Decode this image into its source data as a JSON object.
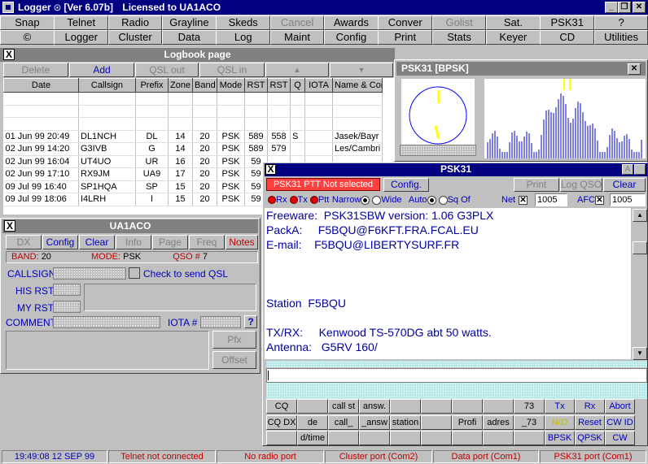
{
  "window": {
    "title": "Logger",
    "version": "[Ver 6.07b]",
    "license": "Licensed to UA1ACO",
    "min_symbol": "_",
    "restore_symbol": "❐",
    "close_symbol": "✕"
  },
  "menu_row1": [
    "Snap",
    "Telnet",
    "Radio",
    "Grayline",
    "Skeds",
    "Cancel",
    "Awards",
    "Conver",
    "Golist",
    "Sat.",
    "PSK31",
    "?"
  ],
  "menu_row2": [
    "©",
    "Logger",
    "Cluster",
    "Data",
    "Log",
    "Maint",
    "Config",
    "Print",
    "Stats",
    "Keyer",
    "CD",
    "Utilities"
  ],
  "logbook": {
    "title": "Logbook page",
    "close_label": "X",
    "toolbar": {
      "delete": "Delete",
      "add": "Add",
      "qsl_out": "QSL out",
      "qsl_in": "QSL in",
      "up": "▲",
      "down": "▼"
    },
    "columns": [
      "Date",
      "Callsign",
      "Prefix",
      "Zone",
      "Band",
      "Mode",
      "RST",
      "RST",
      "Q",
      "IOTA",
      "Name & Com"
    ],
    "rows": [
      [
        "01 Jun 99  20:49",
        "DL1NCH",
        "DL",
        "14",
        "20",
        "PSK",
        "589",
        "558",
        "S",
        "",
        "Jasek/Bayr"
      ],
      [
        "02 Jun 99  14:20",
        "G3IVB",
        "G",
        "14",
        "20",
        "PSK",
        "589",
        "579",
        "",
        "",
        "Les/Cambri"
      ],
      [
        "02 Jun 99  16:04",
        "UT4UO",
        "UR",
        "16",
        "20",
        "PSK",
        "59",
        "",
        "",
        "",
        ""
      ],
      [
        "02 Jun 99  17:10",
        "RX9JM",
        "UA9",
        "17",
        "20",
        "PSK",
        "59",
        "",
        "",
        "",
        ""
      ],
      [
        "09 Jul 99  16:40",
        "SP1HQA",
        "SP",
        "15",
        "20",
        "PSK",
        "59",
        "",
        "",
        "",
        ""
      ],
      [
        "09 Jul 99  18:06",
        "I4LRH",
        "I",
        "15",
        "20",
        "PSK",
        "59",
        "",
        "",
        "",
        ""
      ]
    ]
  },
  "qso_panel": {
    "title": "UA1ACO",
    "close_label": "X",
    "buttons": {
      "dx": "DX",
      "config": "Config",
      "clear": "Clear",
      "info": "Info",
      "page": "Page",
      "freq": "Freq",
      "notes": "Notes"
    },
    "band_label": "BAND:",
    "band_value": "20",
    "mode_label": "MODE:",
    "mode_value": "PSK",
    "qso_label": "QSO #",
    "qso_value": "7",
    "callsign_label": "CALLSIGN",
    "check_qsl_label": "Check to send QSL",
    "his_rst_label": "HIS RST",
    "my_rst_label": "MY RST",
    "comment_label": "COMMENT",
    "iota_label": "IOTA #",
    "help_label": "?",
    "pfx_label": "Pfx",
    "offset_label": "Offset"
  },
  "bpsk_window": {
    "title": "PSK31 [BPSK]",
    "close_symbol": "✕"
  },
  "psk31": {
    "title": "PSK31",
    "close_label": "X",
    "a_label": "A",
    "ptt_status": "PSK31 PTT Not selected",
    "config": "Config.",
    "print": "Print",
    "log_qso": "Log QSO",
    "clear": "Clear",
    "rx_label": "Rx",
    "tx_label": "Tx",
    "ptt_label": "Ptt",
    "narrow_label": "Narrow",
    "wide_label": "Wide",
    "auto_label": "Auto",
    "sqoff_label": "Sq Of",
    "net_label": "Net",
    "net_value": "1005",
    "afc_label": "AFC",
    "afc_value": "1005",
    "check_mark": "✕",
    "terminal_lines": [
      "Freeware:  PSK31SBW version: 1.06 G3PLX",
      "PackA:     F5BQU@F6KFT.FRA.FCAL.EU",
      "E-mail:    F5BQU@LIBERTYSURF.FR",
      "",
      "",
      "",
      "Station  F5BQU",
      "",
      "TX/RX:     Kenwood TS-570DG abt 50 watts.",
      "Antenna:   G5RV 160/"
    ],
    "scroll_up": "▲",
    "scroll_down": "▼",
    "macros_row1": [
      "CQ",
      "",
      "call st",
      "answ.",
      "",
      "",
      "",
      "",
      "73",
      "Tx",
      "Rx",
      "Abort"
    ],
    "macros_row2": [
      "CQ DX",
      "de",
      "call_",
      "_answ",
      "station",
      "",
      "Profi",
      "adres",
      "_73",
      "N/O",
      "Reset",
      "CW ID"
    ],
    "macros_row3": [
      "",
      "d/time",
      "",
      "",
      "",
      "",
      "",
      "",
      "",
      "BPSK",
      "QPSK",
      "CW"
    ]
  },
  "status": {
    "time": "19:49:08  12 SEP 99",
    "telnet": "Telnet not connected",
    "radio": "No radio port",
    "cluster": "Cluster port (Com2)",
    "data": "Data port (Com1)",
    "psk31": "PSK31 port (Com1)"
  }
}
